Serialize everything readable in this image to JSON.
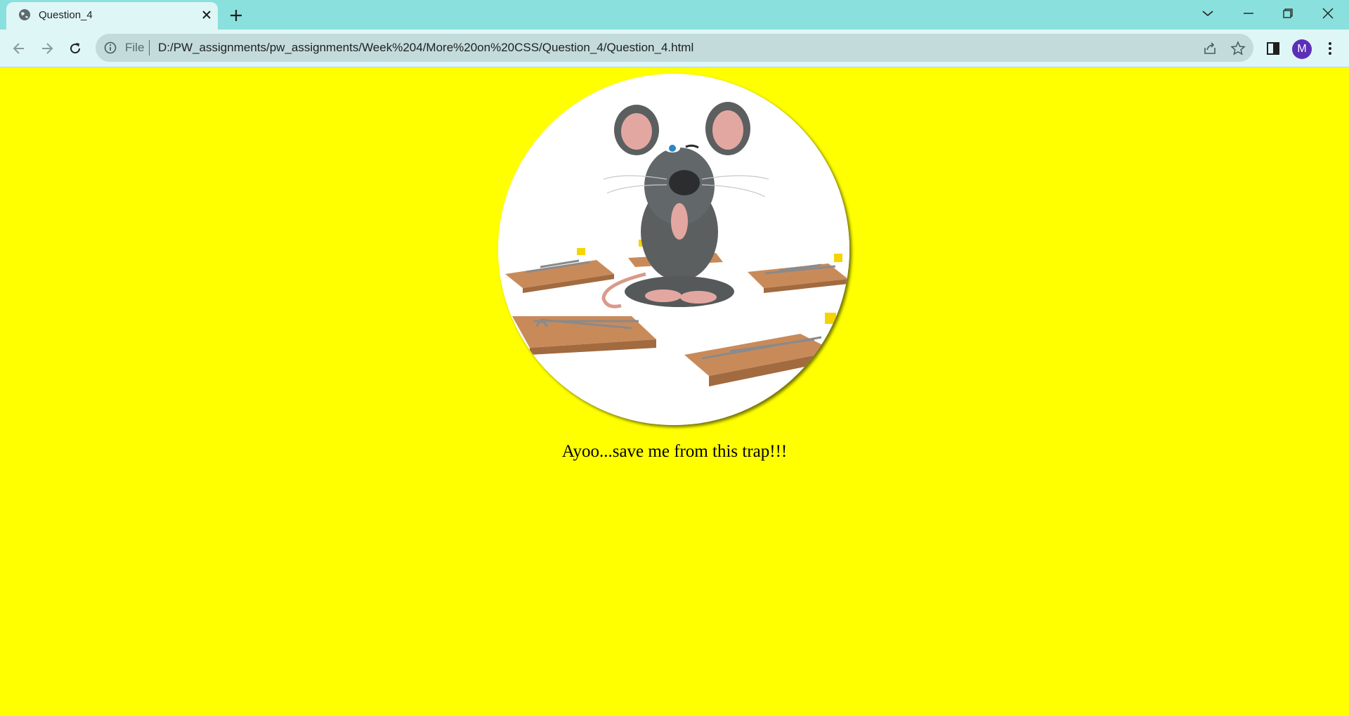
{
  "browser": {
    "tab": {
      "title": "Question_4",
      "favicon": "globe-icon"
    },
    "address_bar": {
      "scheme_label": "File",
      "url": "D:/PW_assignments/pw_assignments/Week%204/More%20on%20CSS/Question_4/Question_4.html"
    },
    "profile_initial": "M",
    "accent_color": "#5b2fb8",
    "tabstrip_color": "#8ae0dd"
  },
  "page": {
    "background_color": "#ffff00",
    "image": {
      "subject": "gray cartoon mouse meditating surrounded by mousetraps",
      "shape": "circle"
    },
    "caption": "Ayoo...save me from this trap!!!"
  }
}
